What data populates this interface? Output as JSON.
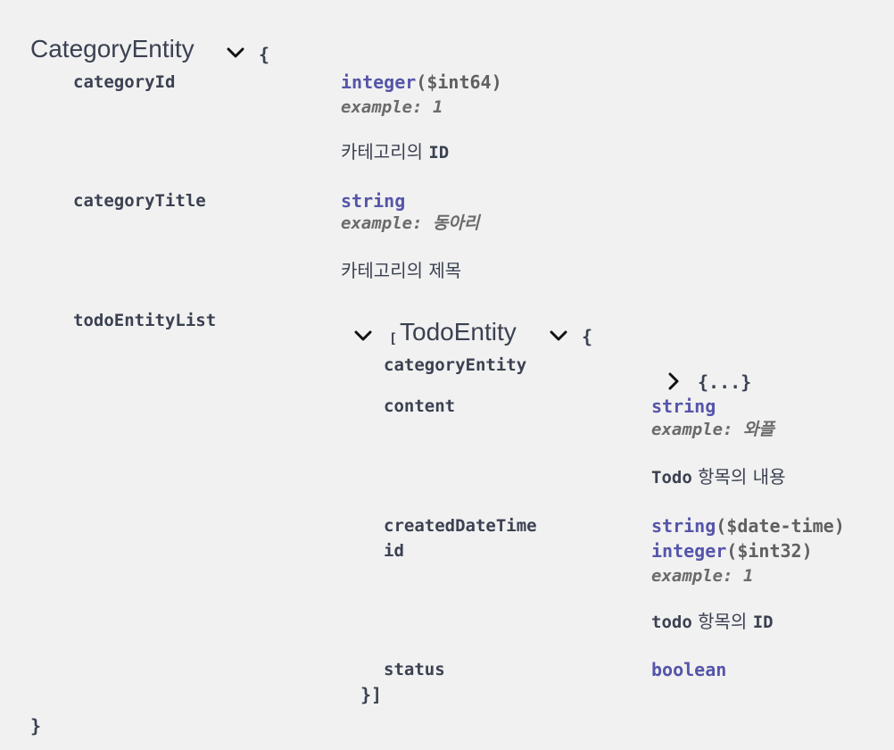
{
  "model": {
    "title": "CategoryEntity",
    "open_brace": "{",
    "close_brace": "}",
    "properties": {
      "categoryId": {
        "name": "categoryId",
        "type": "integer",
        "format": "($int64)",
        "example": "example: 1",
        "description_text": "카테고리의",
        "description_code": "ID"
      },
      "categoryTitle": {
        "name": "categoryTitle",
        "type": "string",
        "example": "example: 동아리",
        "description": "카테고리의 제목"
      },
      "todoEntityList": {
        "name": "todoEntityList"
      }
    }
  },
  "nested_model": {
    "open_bracket": "[",
    "title": "TodoEntity",
    "open_brace": "{",
    "close": "}]",
    "properties": {
      "categoryEntity": {
        "name": "categoryEntity",
        "collapsed": "{...}"
      },
      "content": {
        "name": "content",
        "type": "string",
        "example": "example: 와플",
        "description_code": "Todo",
        "description_text": "항목의 내용"
      },
      "createdDateTime": {
        "name": "createdDateTime",
        "type": "string",
        "format": "($date-time)"
      },
      "id": {
        "name": "id",
        "type": "integer",
        "format": "($int32)",
        "example": "example: 1",
        "description_code": "todo",
        "description_text": "항목의",
        "description_code2": "ID"
      },
      "status": {
        "name": "status",
        "type": "boolean"
      }
    }
  },
  "icons": {
    "model_toggle": "chevron-down-icon",
    "list_toggle": "chevron-down-icon",
    "nested_toggle": "chevron-down-icon",
    "category_entity_toggle": "chevron-right-icon"
  }
}
